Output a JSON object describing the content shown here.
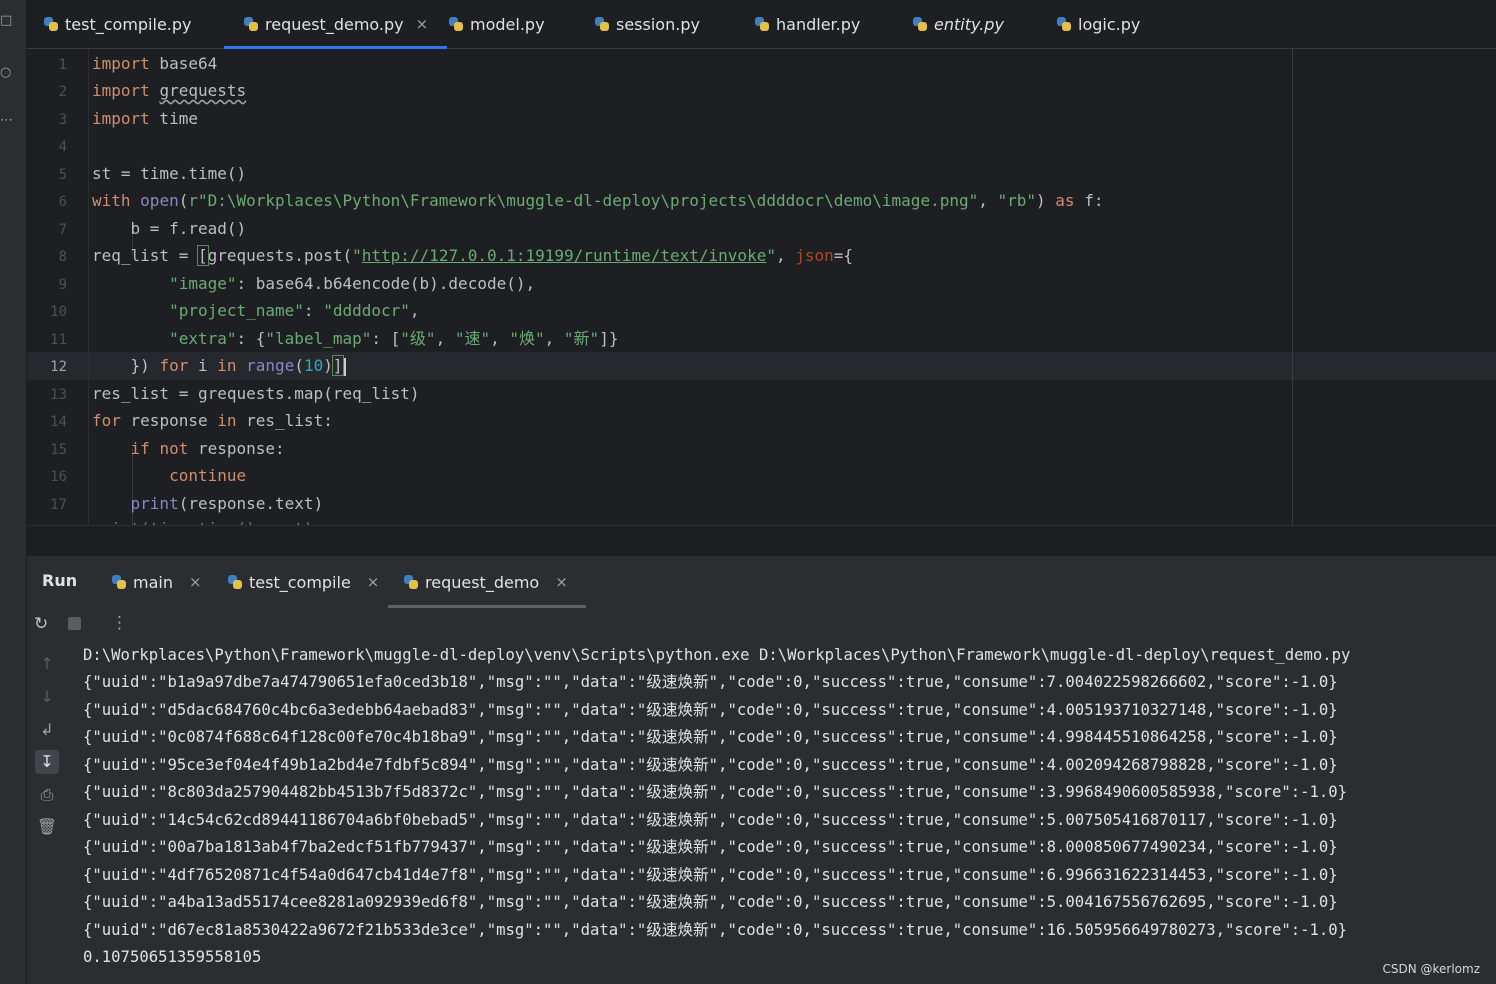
{
  "editor_tabs": [
    {
      "label": "test_compile.py",
      "active": false,
      "italic": false
    },
    {
      "label": "request_demo.py",
      "active": true,
      "italic": false,
      "closable": true
    },
    {
      "label": "model.py",
      "active": false,
      "italic": false
    },
    {
      "label": "session.py",
      "active": false,
      "italic": false
    },
    {
      "label": "handler.py",
      "active": false,
      "italic": false
    },
    {
      "label": "entity.py",
      "active": false,
      "italic": true
    },
    {
      "label": "logic.py",
      "active": false,
      "italic": false
    }
  ],
  "tab_close_glyph": "×",
  "editor": {
    "current_line": 12,
    "line_numbers": [
      "1",
      "2",
      "3",
      "4",
      "5",
      "6",
      "7",
      "8",
      "9",
      "10",
      "11",
      "12",
      "13",
      "14",
      "15",
      "16",
      "17"
    ],
    "code": {
      "l1_kw": "import",
      "l1_mod": " base64",
      "l2_kw": "import",
      "l2_mod": "grequests",
      "l3_kw": "import",
      "l3_mod": " time",
      "l5": "st = time.time()",
      "l6_kw": "with",
      "l6_open": "open",
      "l6_path": "r\"D:\\Workplaces\\Python\\Framework\\muggle-dl-deploy\\projects\\ddddocr\\demo\\image.png\"",
      "l6_mode": "\"rb\"",
      "l6_as": "as",
      "l6_f": " f:",
      "l7": "    b = f.read()",
      "l8_a": "req_list = ",
      "l8_b": "[",
      "l8_c": "grequests.post(",
      "l8_q1": "\"",
      "l8_url": "http://127.0.0.1:19199/runtime/text/invoke",
      "l8_q2": "\"",
      "l8_comma": ", ",
      "l8_json": "json",
      "l8_end": "={",
      "l9_key": "\"image\"",
      "l9_rest": ": base64.b64encode(b).decode(),",
      "l10_key": "\"project_name\"",
      "l10_colon": ": ",
      "l10_val": "\"ddddocr\"",
      "l10_comma": ",",
      "l11_key": "\"extra\"",
      "l11_a": ": {",
      "l11_lm": "\"label_map\"",
      "l11_b": ": [",
      "l11_v1": "\"级\"",
      "l11_v2": "\"速\"",
      "l11_v3": "\"焕\"",
      "l11_v4": "\"新\"",
      "l11_sep": ", ",
      "l11_end": "]}",
      "l12_a": "    }) ",
      "l12_for": "for",
      "l12_i": " i ",
      "l12_in": "in",
      "l12_range": "range",
      "l12_p1": "(",
      "l12_n": "10",
      "l12_p2": ")",
      "l12_br": "]",
      "l13": "res_list = grequests.map(req_list)",
      "l14_for": "for",
      "l14_mid": " response ",
      "l14_in": "in",
      "l14_end": " res_list:",
      "l15_if": "if",
      "l15_not": "not",
      "l15_end": " response:",
      "l16": "continue",
      "l17_print": "print",
      "l17_end": "(response.text)",
      "l18_partial": "print(time.time() - st)"
    }
  },
  "run_panel": {
    "title": "Run",
    "tabs": [
      {
        "label": "main",
        "active": false
      },
      {
        "label": "test_compile",
        "active": false
      },
      {
        "label": "request_demo",
        "active": true
      }
    ],
    "console_lines": [
      "D:\\Workplaces\\Python\\Framework\\muggle-dl-deploy\\venv\\Scripts\\python.exe D:\\Workplaces\\Python\\Framework\\muggle-dl-deploy\\request_demo.py",
      "{\"uuid\":\"b1a9a97dbe7a474790651efa0ced3b18\",\"msg\":\"\",\"data\":\"级速焕新\",\"code\":0,\"success\":true,\"consume\":7.004022598266602,\"score\":-1.0}",
      "{\"uuid\":\"d5dac684760c4bc6a3edebb64aebad83\",\"msg\":\"\",\"data\":\"级速焕新\",\"code\":0,\"success\":true,\"consume\":4.005193710327148,\"score\":-1.0}",
      "{\"uuid\":\"0c0874f688c64f128c00fe70c4b18ba9\",\"msg\":\"\",\"data\":\"级速焕新\",\"code\":0,\"success\":true,\"consume\":4.998445510864258,\"score\":-1.0}",
      "{\"uuid\":\"95ce3ef04e4f49b1a2bd4e7fdbf5c894\",\"msg\":\"\",\"data\":\"级速焕新\",\"code\":0,\"success\":true,\"consume\":4.002094268798828,\"score\":-1.0}",
      "{\"uuid\":\"8c803da257904482bb4513b7f5d8372c\",\"msg\":\"\",\"data\":\"级速焕新\",\"code\":0,\"success\":true,\"consume\":3.9968490600585938,\"score\":-1.0}",
      "{\"uuid\":\"14c54c62cd89441186704a6bf0bebad5\",\"msg\":\"\",\"data\":\"级速焕新\",\"code\":0,\"success\":true,\"consume\":5.007505416870117,\"score\":-1.0}",
      "{\"uuid\":\"00a7ba1813ab4f7ba2edcf51fb779437\",\"msg\":\"\",\"data\":\"级速焕新\",\"code\":0,\"success\":true,\"consume\":8.000850677490234,\"score\":-1.0}",
      "{\"uuid\":\"4df76520871c4f54a0d647cb41d4e7f8\",\"msg\":\"\",\"data\":\"级速焕新\",\"code\":0,\"success\":true,\"consume\":6.996631622314453,\"score\":-1.0}",
      "{\"uuid\":\"a4ba13ad55174cee8281a092939ed6f8\",\"msg\":\"\",\"data\":\"级速焕新\",\"code\":0,\"success\":true,\"consume\":5.004167556762695,\"score\":-1.0}",
      "{\"uuid\":\"d67ec81a8530422a9672f21b533de3ce\",\"msg\":\"\",\"data\":\"级速焕新\",\"code\":0,\"success\":true,\"consume\":16.505956649780273,\"score\":-1.0}",
      "0.10750651359558105"
    ],
    "toolbar_icons": [
      "rerun-icon",
      "stop-icon",
      "more-icon"
    ],
    "side_icons": [
      "up-arrow-icon",
      "down-arrow-icon",
      "soft-wrap-icon",
      "scroll-to-end-icon",
      "print-icon",
      "trash-icon"
    ]
  },
  "watermark": "CSDN @kerlomz",
  "colors": {
    "background": "#1e1f22",
    "panel": "#2b2d30",
    "keyword": "#cf8e6d",
    "string": "#6aab73",
    "number": "#2aacb8",
    "builtin": "#8888c6",
    "parameter": "#aa4926",
    "accent": "#3574f0"
  }
}
